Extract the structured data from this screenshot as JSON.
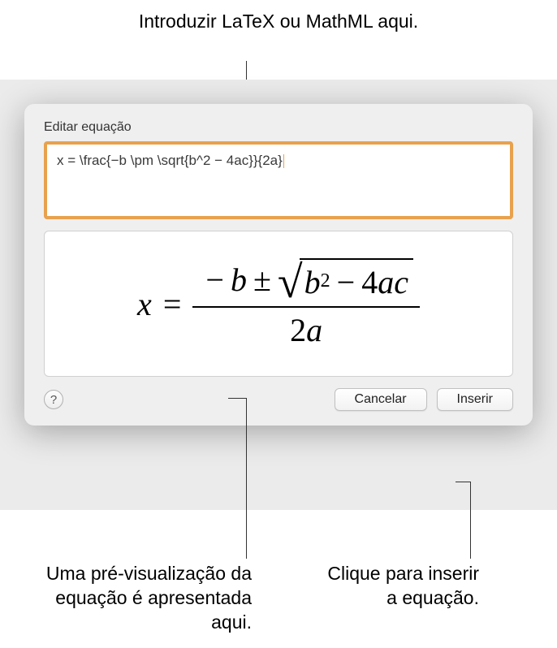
{
  "callouts": {
    "top": "Introduzir LaTeX ou MathML aqui.",
    "bottom_left": "Uma pré-visualização da equação é apresentada aqui.",
    "bottom_right": "Clique para inserir a equação."
  },
  "dialog": {
    "title": "Editar equação",
    "input_value": "x = \\frac{−b \\pm \\sqrt{b^2 − 4ac}}{2a}",
    "help_label": "?",
    "cancel_label": "Cancelar",
    "insert_label": "Inserir"
  },
  "preview": {
    "lhs": "x",
    "eq": "=",
    "neg": "−",
    "b": "b",
    "pm": "±",
    "sqrt_b": "b",
    "sqrt_exp": "2",
    "sqrt_minus": "−",
    "sqrt_4": "4",
    "sqrt_a": "a",
    "sqrt_c": "c",
    "den_2": "2",
    "den_a": "a"
  }
}
